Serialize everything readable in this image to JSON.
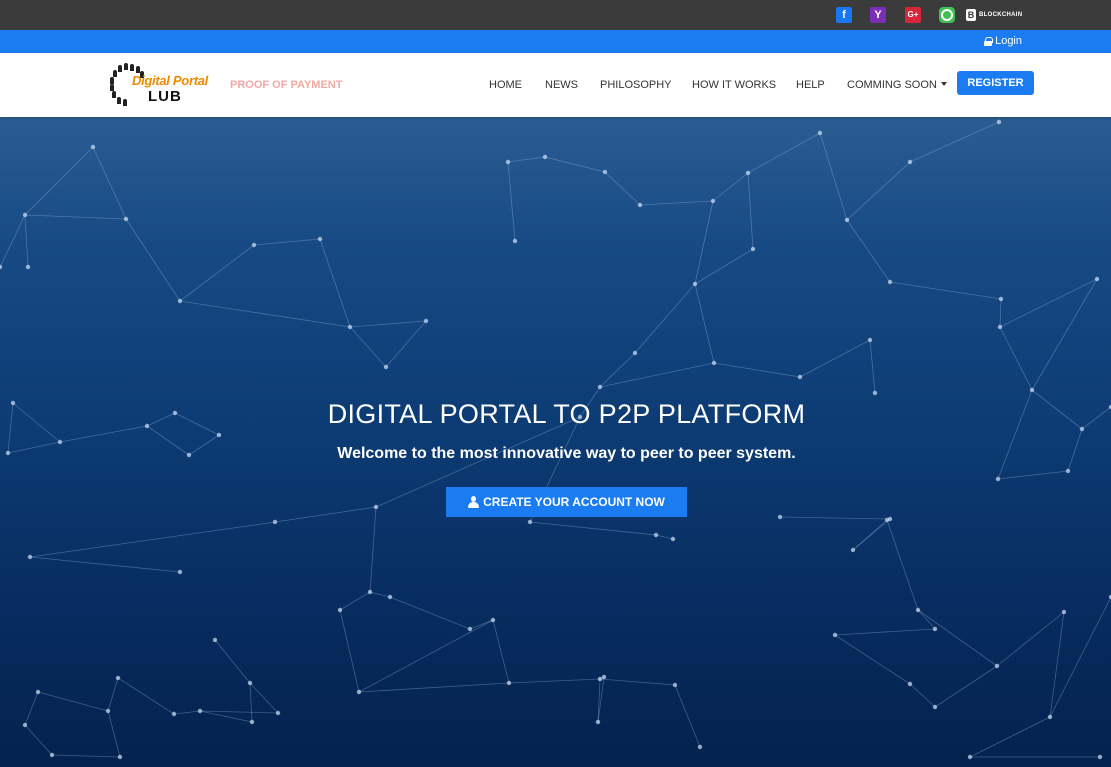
{
  "topbar": {
    "social": [
      {
        "name": "facebook",
        "glyph": "f",
        "color": "#1877f2"
      },
      {
        "name": "yahoo",
        "glyph": "Y",
        "color": "#7b2fb5"
      },
      {
        "name": "google-plus",
        "glyph": "G+",
        "color": "#d9253a"
      },
      {
        "name": "whatsapp",
        "glyph": "",
        "color": "#3ec152"
      }
    ],
    "blockchain_label": "BLOCKCHAIN"
  },
  "loginbar": {
    "login_label": "Login",
    "color": "#1b7cf2"
  },
  "brand": {
    "logo_line1": "Digital Portal",
    "logo_line2": "LUB",
    "proof_link": "PROOF OF PAYMENT"
  },
  "nav": {
    "items": [
      "HOME",
      "NEWS",
      "PHILOSOPHY",
      "HOW IT WORKS",
      "HELP",
      "COMMING SOON"
    ],
    "register_label": "REGISTER"
  },
  "hero": {
    "title": "DIGITAL PORTAL TO P2P PLATFORM",
    "subtitle": "Welcome to the most innovative way to peer to peer system.",
    "cta_label": "CREATE YOUR ACCOUNT NOW",
    "accent": "#1b7cf2"
  }
}
